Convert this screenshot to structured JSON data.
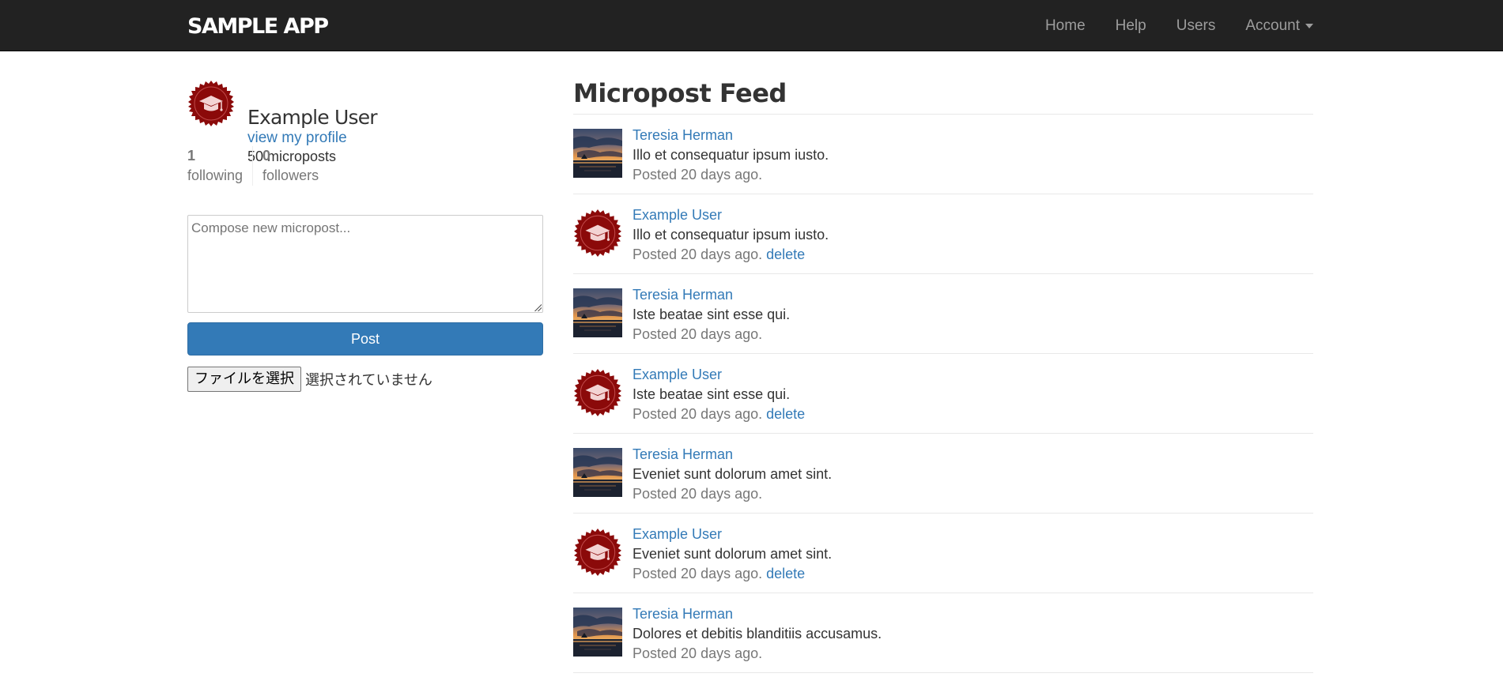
{
  "nav": {
    "brand": "SAMPLE APP",
    "links": [
      {
        "label": "Home"
      },
      {
        "label": "Help"
      },
      {
        "label": "Users"
      },
      {
        "label": "Account"
      }
    ]
  },
  "user": {
    "name": "Example User",
    "profile_link": "view my profile",
    "post_count": "50 microposts",
    "following_count": "1",
    "following_label": "following",
    "followers_count": "0",
    "followers_label": "followers"
  },
  "composer": {
    "placeholder": "Compose new micropost...",
    "post_label": "Post",
    "file_button_label": "ファイルを選択",
    "file_status": "選択されていません"
  },
  "feed": {
    "title": "Micropost Feed",
    "delete_label": "delete",
    "items": [
      {
        "user": "Teresia Herman",
        "content": "Illo et consequatur ipsum iusto.",
        "time": "Posted 20 days ago.",
        "avatar": "sunset-photo"
      },
      {
        "user": "Example User",
        "content": "Illo et consequatur ipsum iusto.",
        "time": "Posted 20 days ago.",
        "avatar": "graduation-badge"
      },
      {
        "user": "Teresia Herman",
        "content": "Iste beatae sint esse qui.",
        "time": "Posted 20 days ago.",
        "avatar": "sunset-photo"
      },
      {
        "user": "Example User",
        "content": "Iste beatae sint esse qui.",
        "time": "Posted 20 days ago.",
        "avatar": "graduation-badge"
      },
      {
        "user": "Teresia Herman",
        "content": "Eveniet sunt dolorum amet sint.",
        "time": "Posted 20 days ago.",
        "avatar": "sunset-photo"
      },
      {
        "user": "Example User",
        "content": "Eveniet sunt dolorum amet sint.",
        "time": "Posted 20 days ago.",
        "avatar": "graduation-badge"
      },
      {
        "user": "Teresia Herman",
        "content": "Dolores et debitis blanditiis accusamus.",
        "time": "Posted 20 days ago.",
        "avatar": "sunset-photo"
      }
    ]
  },
  "colors": {
    "navbar": "#222222",
    "link": "#337ab7",
    "button": "#337ab7",
    "badge": "#8b0a0a"
  }
}
